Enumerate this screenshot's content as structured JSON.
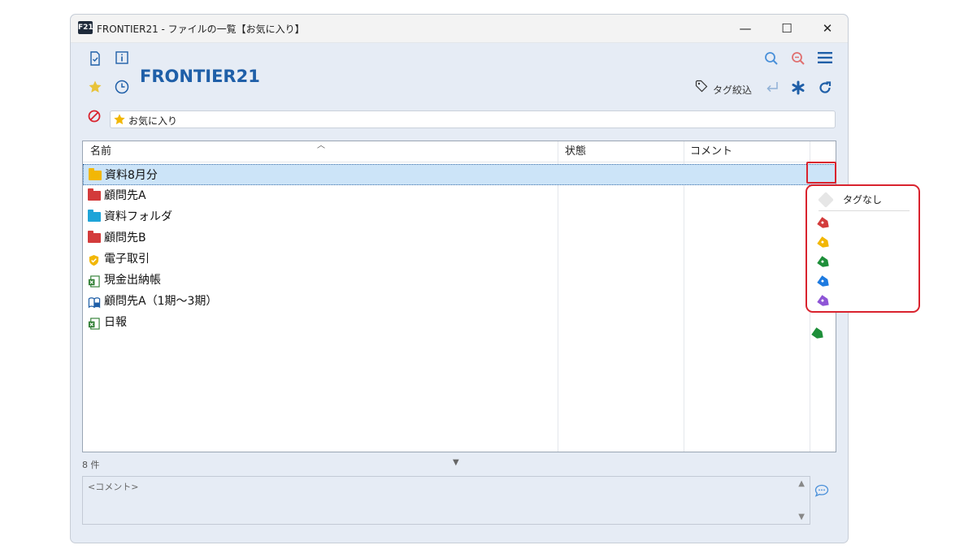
{
  "window": {
    "logo": "F21",
    "title": "FRONTIER21 - ファイルの一覧【お気に入り】",
    "minimize": "—",
    "maximize": "☐",
    "close": "✕"
  },
  "toolbar": {
    "brand": "FRONTIER21",
    "tag_filter_label": "タグ絞込"
  },
  "search": {
    "value": "お気に入り"
  },
  "list": {
    "columns": [
      "名前",
      "状態",
      "コメント"
    ],
    "rows": [
      {
        "name": "資料8月分",
        "icon": "folder-yellow-icon",
        "color": "#f2b705"
      },
      {
        "name": "顧問先A",
        "icon": "folder-red-icon",
        "color": "#d33b3b"
      },
      {
        "name": "資料フォルダ",
        "icon": "folder-blue-icon",
        "color": "#1ea4d8"
      },
      {
        "name": "顧問先B",
        "icon": "folder-red-icon",
        "color": "#d33b3b"
      },
      {
        "name": "電子取引",
        "icon": "shield-check-icon",
        "color": "#f2b705"
      },
      {
        "name": "現金出納帳",
        "icon": "spreadsheet-icon",
        "color": "#2e7d32"
      },
      {
        "name": "顧問先A（1期～3期）",
        "icon": "book-icon",
        "color": "#1f5fa8"
      },
      {
        "name": "日報",
        "icon": "spreadsheet-icon",
        "color": "#2e7d32"
      }
    ]
  },
  "status": {
    "count": "8 件"
  },
  "comment": {
    "placeholder": "<コメント>"
  },
  "tag_popup": {
    "none_label": "タグなし",
    "tags": [
      {
        "name": "red-tag-icon",
        "color": "#d33b3b"
      },
      {
        "name": "yellow-tag-icon",
        "color": "#f2b705"
      },
      {
        "name": "green-tag-icon",
        "color": "#1e8f3a"
      },
      {
        "name": "blue-tag-icon",
        "color": "#1e7be0"
      },
      {
        "name": "purple-tag-icon",
        "color": "#8e55d6"
      }
    ]
  },
  "row_tags": {
    "nippo_tag_color": "#1e8f3a"
  },
  "colors": {
    "accent": "#1f5fa8",
    "highlight": "#d9232e"
  }
}
